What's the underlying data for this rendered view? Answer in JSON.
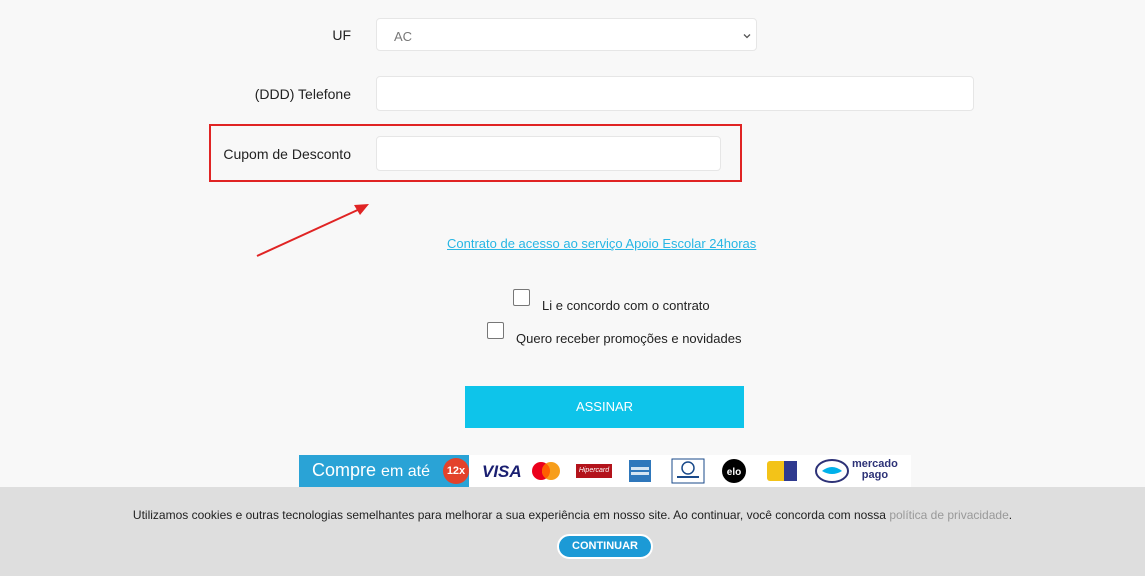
{
  "form": {
    "uf_label": "UF",
    "uf_value": "AC",
    "telefone_label": "(DDD) Telefone",
    "telefone_value": "",
    "cupom_label": "Cupom de Desconto",
    "cupom_value": ""
  },
  "contract_link": "Contrato de acesso ao serviço Apoio Escolar 24horas",
  "checkboxes": [
    {
      "label": "Li e concordo com o contrato",
      "checked": false
    },
    {
      "label": "Quero receber promoções e novidades",
      "checked": false
    }
  ],
  "submit_label": "ASSINAR",
  "payment": {
    "text_prefix": "Compre",
    "text_suffix": "em até",
    "installments": "12x",
    "brands": [
      "VISA",
      "MasterCard",
      "Hipercard",
      "American Express",
      "Diners Club",
      "elo",
      "Hiper",
      "mercado pago"
    ],
    "visa": "VISA",
    "hipercard": "Hipercard",
    "mercado_top": "mercado",
    "mercado_bottom": "pago"
  },
  "cookie": {
    "text": "Utilizamos cookies e outras tecnologias semelhantes para melhorar a sua experiência em nosso site. Ao continuar, você concorda com nossa",
    "link": "política de privacidade",
    "suffix": ".",
    "button": "CONTINUAR"
  },
  "colors": {
    "highlight": "#e02424",
    "accent": "#0ec4ea",
    "link": "#27b6e4",
    "continue_button": "#1c9ad6"
  }
}
